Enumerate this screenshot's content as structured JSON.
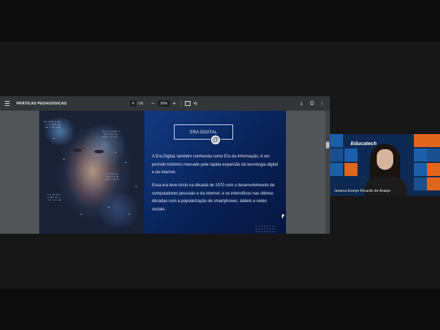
{
  "viewer": {
    "doc_title": "PRÁTICAS PEDAGÓGICAS",
    "page_current": "4",
    "page_total": "/ 56",
    "zoom_minus": "−",
    "zoom_value": "50%",
    "zoom_plus": "+",
    "icons": [
      "menu-icon",
      "fit-page-icon",
      "rotate-icon",
      "download-icon",
      "print-icon",
      "more-options-icon"
    ]
  },
  "slide": {
    "title": "ERA DIGITAL",
    "at_symbol": "@",
    "paragraph1": "A Era Digital, também conhecida como Era da Informação, é um período histórico marcado pela rápida expansão da tecnologia digital e da internet.",
    "paragraph2": "Essa era teve início na década de 1970 com o desenvolvimento de computadores pessoais e da internet, e se intensificou nas últimas décadas com a popularização de smartphones, tablets e redes sociais."
  },
  "webcam": {
    "logo": "Educatech",
    "participant_name": "Jessica Evelyn Ricardo de Araújo"
  },
  "colors": {
    "slide_bg": "#0d2353",
    "toolbar_bg": "#323639",
    "viewer_bg": "#525659",
    "webcam_tile_blue": "#1b5fa8",
    "webcam_tile_orange": "#e0661c"
  }
}
